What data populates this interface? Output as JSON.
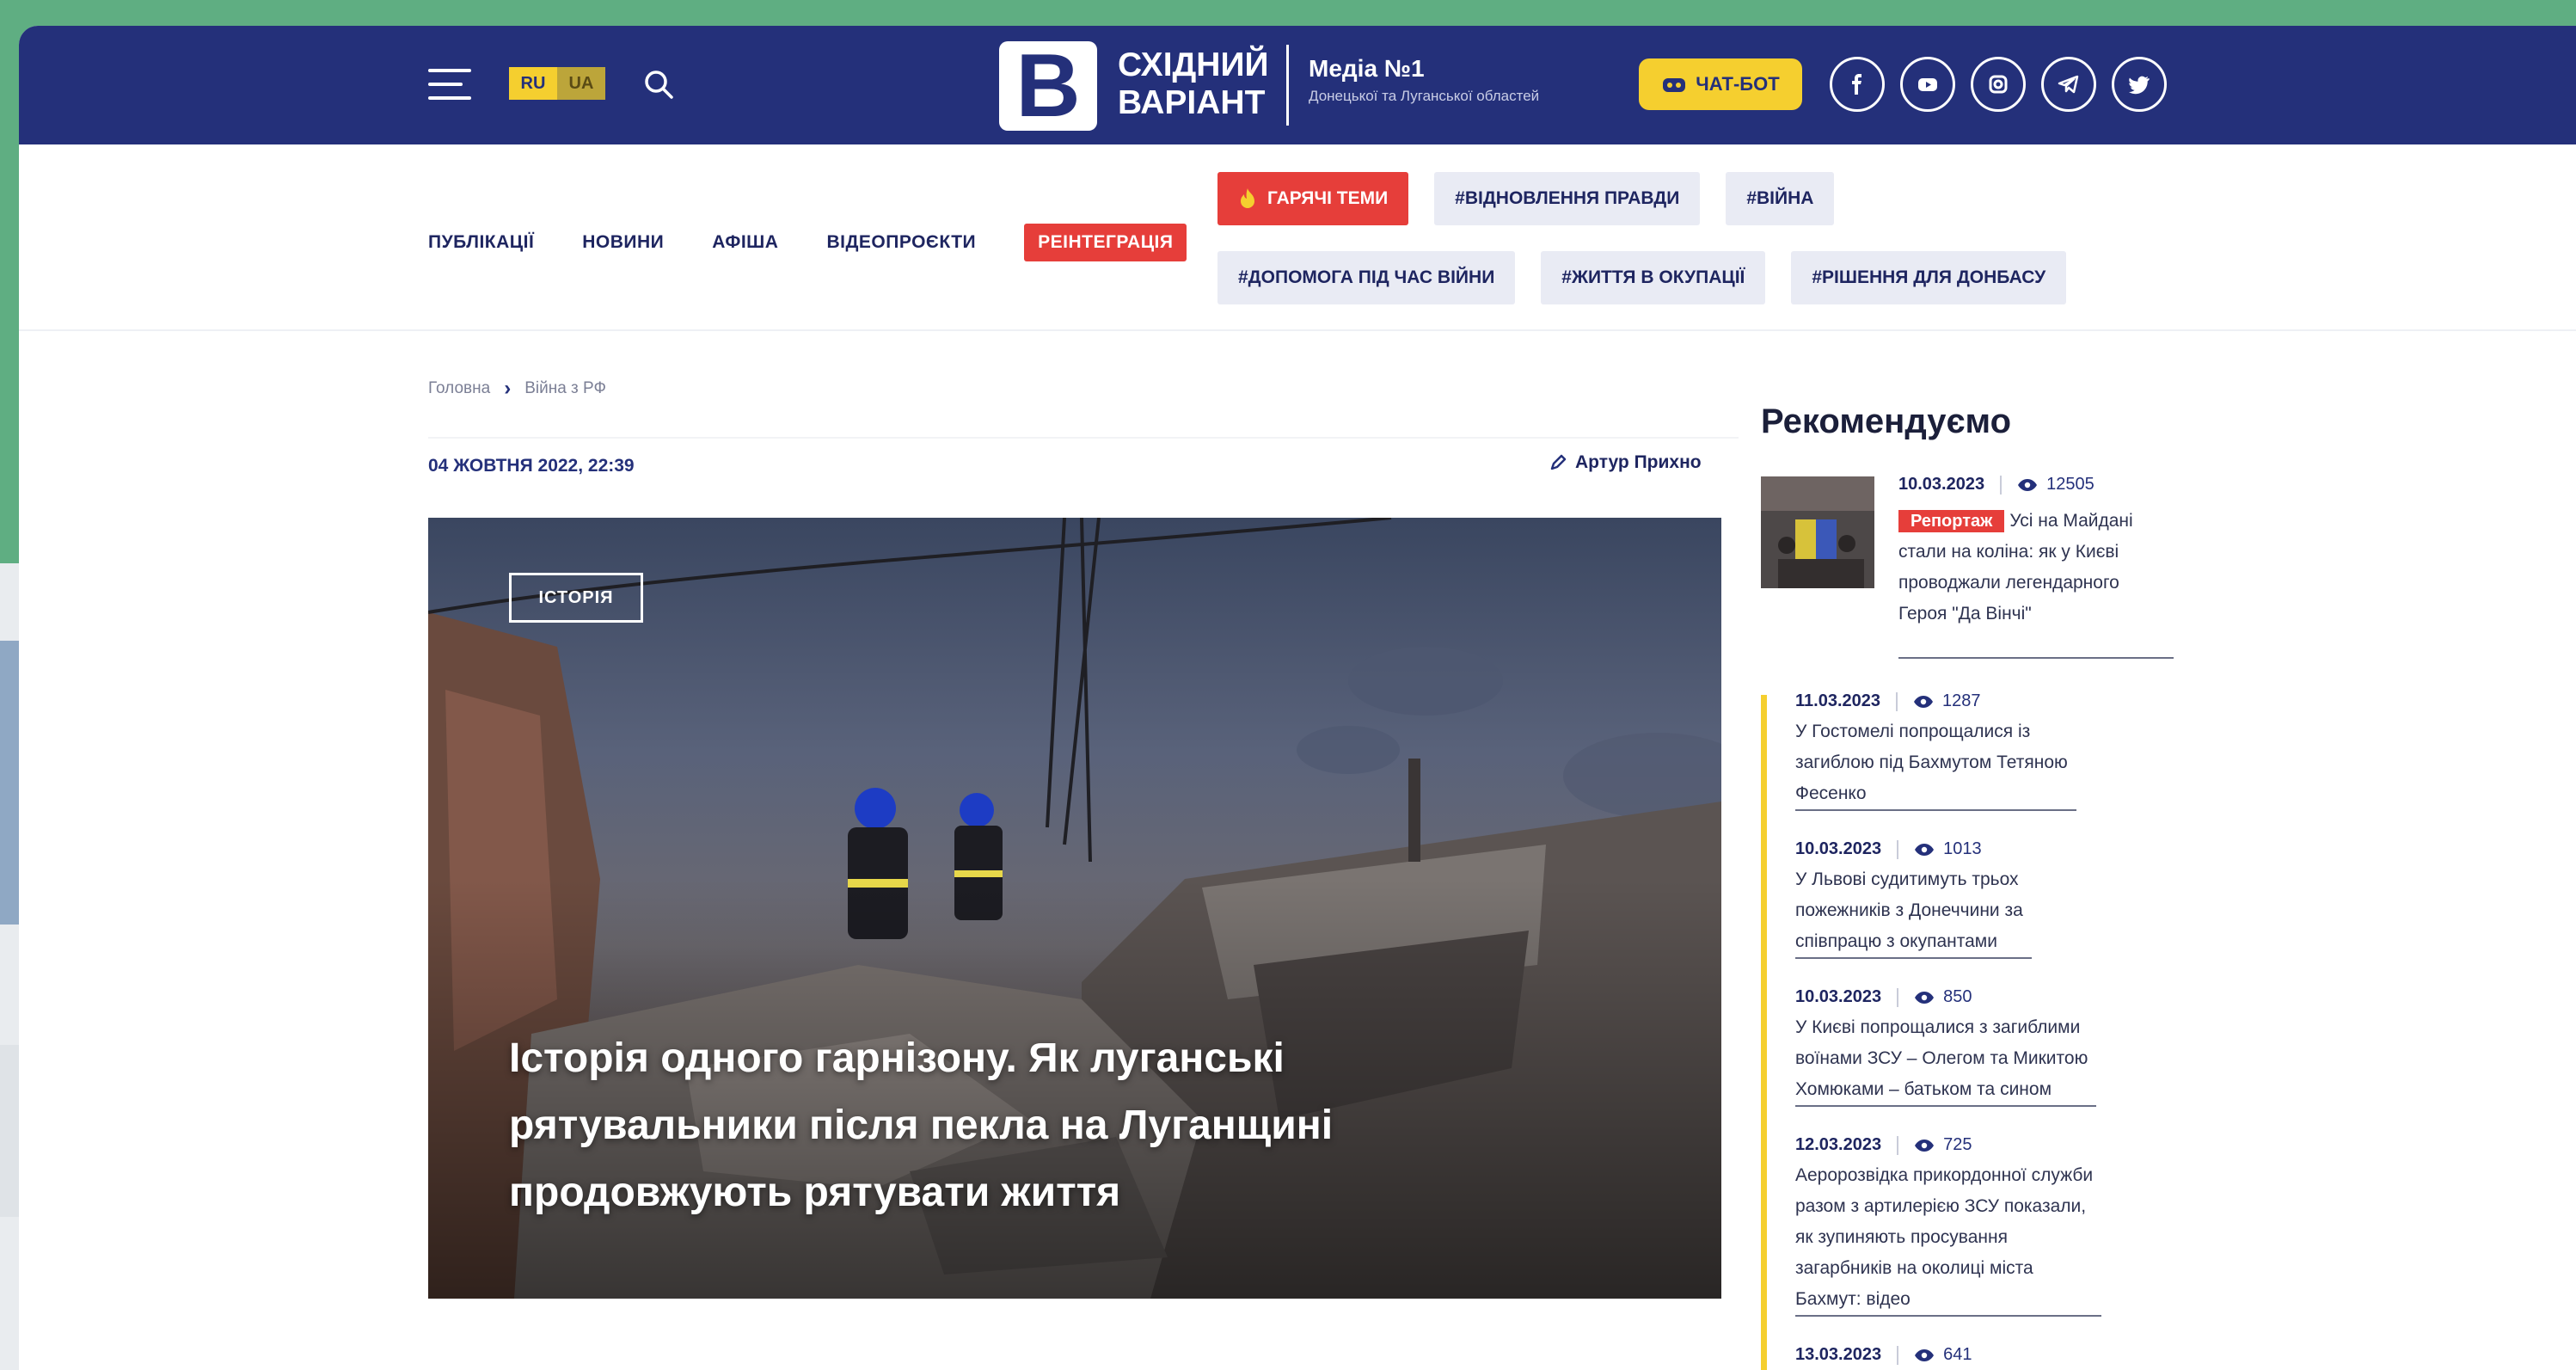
{
  "header": {
    "lang_ru": "RU",
    "lang_ua": "UA",
    "logo_letter": "B",
    "logo_line1": "СХІДНИЙ",
    "logo_line2": "ВАРІАНТ",
    "media_title": "Медіа №1",
    "media_subtitle": "Донецької та Луганської областей",
    "chatbot_label": "ЧАТ-БОТ",
    "socials": [
      "facebook-icon",
      "youtube-icon",
      "instagram-icon",
      "telegram-icon",
      "twitter-icon"
    ]
  },
  "nav": {
    "items": [
      "ПУБЛІКАЦІЇ",
      "НОВИНИ",
      "АФІША",
      "ВІДЕОПРОЄКТИ",
      "РЕІНТЕГРАЦІЯ"
    ],
    "tags": [
      "ГАРЯЧІ ТЕМИ",
      "#ВІДНОВЛЕННЯ ПРАВДИ",
      "#ВІЙНА",
      "#ДОПОМОГА ПІД ЧАС ВІЙНИ",
      "#ЖИТТЯ В ОКУПАЦІЇ",
      "#РІШЕННЯ ДЛЯ ДОНБАСУ"
    ]
  },
  "breadcrumb": {
    "home": "Головна",
    "current": "Війна з РФ"
  },
  "article": {
    "date": "04 ЖОВТНЯ 2022, 22:39",
    "author": "Артур Прихно",
    "category": "ІСТОРІЯ",
    "title_line1": "Історія одного гарнізону. Як луганські",
    "title_line2": "рятувальники після пекла на Луганщині",
    "title_line3": "продовжують рятувати життя"
  },
  "sidebar": {
    "title": "Рекомендуємо",
    "featured": {
      "date": "10.03.2023",
      "views": "12505",
      "badge": "Репортаж",
      "text": "Усі на Майдані стали на коліна: як у Києві проводжали легендарного Героя \"Да Вінчі\""
    },
    "items": [
      {
        "date": "11.03.2023",
        "views": "1287",
        "text_lines": [
          "У Гостомелі попрощалися із",
          "загиблою під Бахмутом Тетяною",
          "Фесенко"
        ]
      },
      {
        "date": "10.03.2023",
        "views": "1013",
        "text_lines": [
          "У Львові судитимуть трьох",
          "пожежників з Донеччини за",
          "співпрацю з окупантами"
        ]
      },
      {
        "date": "10.03.2023",
        "views": "850",
        "text_lines": [
          "У Києві попрощалися з загиблими",
          "воїнами ЗСУ – Олегом та Микитою",
          "Хомюками – батьком та сином"
        ]
      },
      {
        "date": "12.03.2023",
        "views": "725",
        "text_lines": [
          "Аеророзвідка прикордонної служби",
          "разом з артилерією ЗСУ показали,",
          "як зупиняють просування",
          "загарбників на околиці міста",
          "Бахмут: відео"
        ]
      },
      {
        "date": "13.03.2023",
        "views": "641",
        "text_lines": []
      }
    ]
  }
}
